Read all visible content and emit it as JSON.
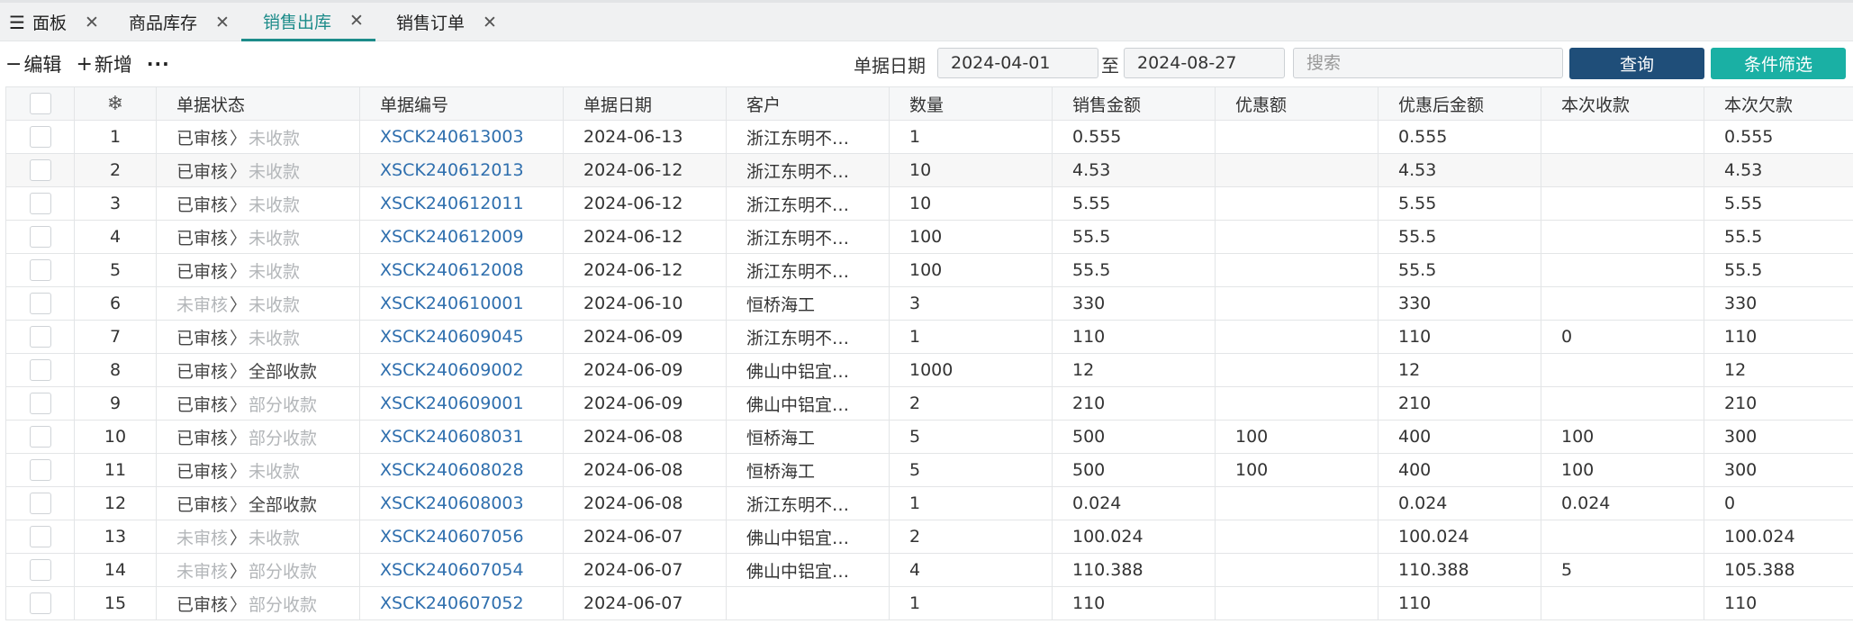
{
  "tabs": [
    {
      "label": "面板",
      "active": false,
      "has_menu_icon": true
    },
    {
      "label": "商品库存",
      "active": false
    },
    {
      "label": "销售出库",
      "active": true
    },
    {
      "label": "销售订单",
      "active": false
    }
  ],
  "toolbar": {
    "edit_label": "编辑",
    "add_label": "新增",
    "more_label": "···",
    "date_label": "单据日期",
    "date_from": "2024-04-01",
    "date_to_sep": "至",
    "date_to": "2024-08-27",
    "search_placeholder": "搜索",
    "query_label": "查询",
    "filter_label": "条件筛选"
  },
  "colors": {
    "accent": "#1d8c8a",
    "query_button": "#1f4e79",
    "filter_button": "#1ab0a4",
    "link": "#2f6fae",
    "muted": "#b3b6b9"
  },
  "table": {
    "columns": [
      "",
      "❄",
      "单据状态",
      "单据编号",
      "单据日期",
      "客户",
      "数量",
      "销售金额",
      "优惠额",
      "优惠后金额",
      "本次收款",
      "本次欠款"
    ],
    "rows": [
      {
        "idx": "1",
        "audit": "已审核",
        "pay": "未收款",
        "no": "XSCK240613003",
        "date": "2024-06-13",
        "customer": "浙江东明不…",
        "qty": "1",
        "amount": "0.555",
        "discount": "",
        "after": "0.555",
        "received": "",
        "owed": "0.555"
      },
      {
        "idx": "2",
        "audit": "已审核",
        "pay": "未收款",
        "no": "XSCK240612013",
        "date": "2024-06-12",
        "customer": "浙江东明不…",
        "qty": "10",
        "amount": "4.53",
        "discount": "",
        "after": "4.53",
        "received": "",
        "owed": "4.53"
      },
      {
        "idx": "3",
        "audit": "已审核",
        "pay": "未收款",
        "no": "XSCK240612011",
        "date": "2024-06-12",
        "customer": "浙江东明不…",
        "qty": "10",
        "amount": "5.55",
        "discount": "",
        "after": "5.55",
        "received": "",
        "owed": "5.55"
      },
      {
        "idx": "4",
        "audit": "已审核",
        "pay": "未收款",
        "no": "XSCK240612009",
        "date": "2024-06-12",
        "customer": "浙江东明不…",
        "qty": "100",
        "amount": "55.5",
        "discount": "",
        "after": "55.5",
        "received": "",
        "owed": "55.5"
      },
      {
        "idx": "5",
        "audit": "已审核",
        "pay": "未收款",
        "no": "XSCK240612008",
        "date": "2024-06-12",
        "customer": "浙江东明不…",
        "qty": "100",
        "amount": "55.5",
        "discount": "",
        "after": "55.5",
        "received": "",
        "owed": "55.5"
      },
      {
        "idx": "6",
        "audit": "未审核",
        "pay": "未收款",
        "no": "XSCK240610001",
        "date": "2024-06-10",
        "customer": "恒桥海工",
        "qty": "3",
        "amount": "330",
        "discount": "",
        "after": "330",
        "received": "",
        "owed": "330"
      },
      {
        "idx": "7",
        "audit": "已审核",
        "pay": "未收款",
        "no": "XSCK240609045",
        "date": "2024-06-09",
        "customer": "浙江东明不…",
        "qty": "1",
        "amount": "110",
        "discount": "",
        "after": "110",
        "received": "0",
        "owed": "110"
      },
      {
        "idx": "8",
        "audit": "已审核",
        "pay": "全部收款",
        "no": "XSCK240609002",
        "date": "2024-06-09",
        "customer": "佛山中铝宜…",
        "qty": "1000",
        "amount": "12",
        "discount": "",
        "after": "12",
        "received": "",
        "owed": "12"
      },
      {
        "idx": "9",
        "audit": "已审核",
        "pay": "部分收款",
        "no": "XSCK240609001",
        "date": "2024-06-09",
        "customer": "佛山中铝宜…",
        "qty": "2",
        "amount": "210",
        "discount": "",
        "after": "210",
        "received": "",
        "owed": "210"
      },
      {
        "idx": "10",
        "audit": "已审核",
        "pay": "部分收款",
        "no": "XSCK240608031",
        "date": "2024-06-08",
        "customer": "恒桥海工",
        "qty": "5",
        "amount": "500",
        "discount": "100",
        "after": "400",
        "received": "100",
        "owed": "300"
      },
      {
        "idx": "11",
        "audit": "已审核",
        "pay": "未收款",
        "no": "XSCK240608028",
        "date": "2024-06-08",
        "customer": "恒桥海工",
        "qty": "5",
        "amount": "500",
        "discount": "100",
        "after": "400",
        "received": "100",
        "owed": "300"
      },
      {
        "idx": "12",
        "audit": "已审核",
        "pay": "全部收款",
        "no": "XSCK240608003",
        "date": "2024-06-08",
        "customer": "浙江东明不…",
        "qty": "1",
        "amount": "0.024",
        "discount": "",
        "after": "0.024",
        "received": "0.024",
        "owed": "0"
      },
      {
        "idx": "13",
        "audit": "未审核",
        "pay": "未收款",
        "no": "XSCK240607056",
        "date": "2024-06-07",
        "customer": "佛山中铝宜…",
        "qty": "2",
        "amount": "100.024",
        "discount": "",
        "after": "100.024",
        "received": "",
        "owed": "100.024"
      },
      {
        "idx": "14",
        "audit": "未审核",
        "pay": "部分收款",
        "no": "XSCK240607054",
        "date": "2024-06-07",
        "customer": "佛山中铝宜…",
        "qty": "4",
        "amount": "110.388",
        "discount": "",
        "after": "110.388",
        "received": "5",
        "owed": "105.388"
      },
      {
        "idx": "15",
        "audit": "已审核",
        "pay": "部分收款",
        "no": "XSCK240607052",
        "date": "2024-06-07",
        "customer": "",
        "qty": "1",
        "amount": "110",
        "discount": "",
        "after": "110",
        "received": "",
        "owed": "110"
      }
    ]
  }
}
